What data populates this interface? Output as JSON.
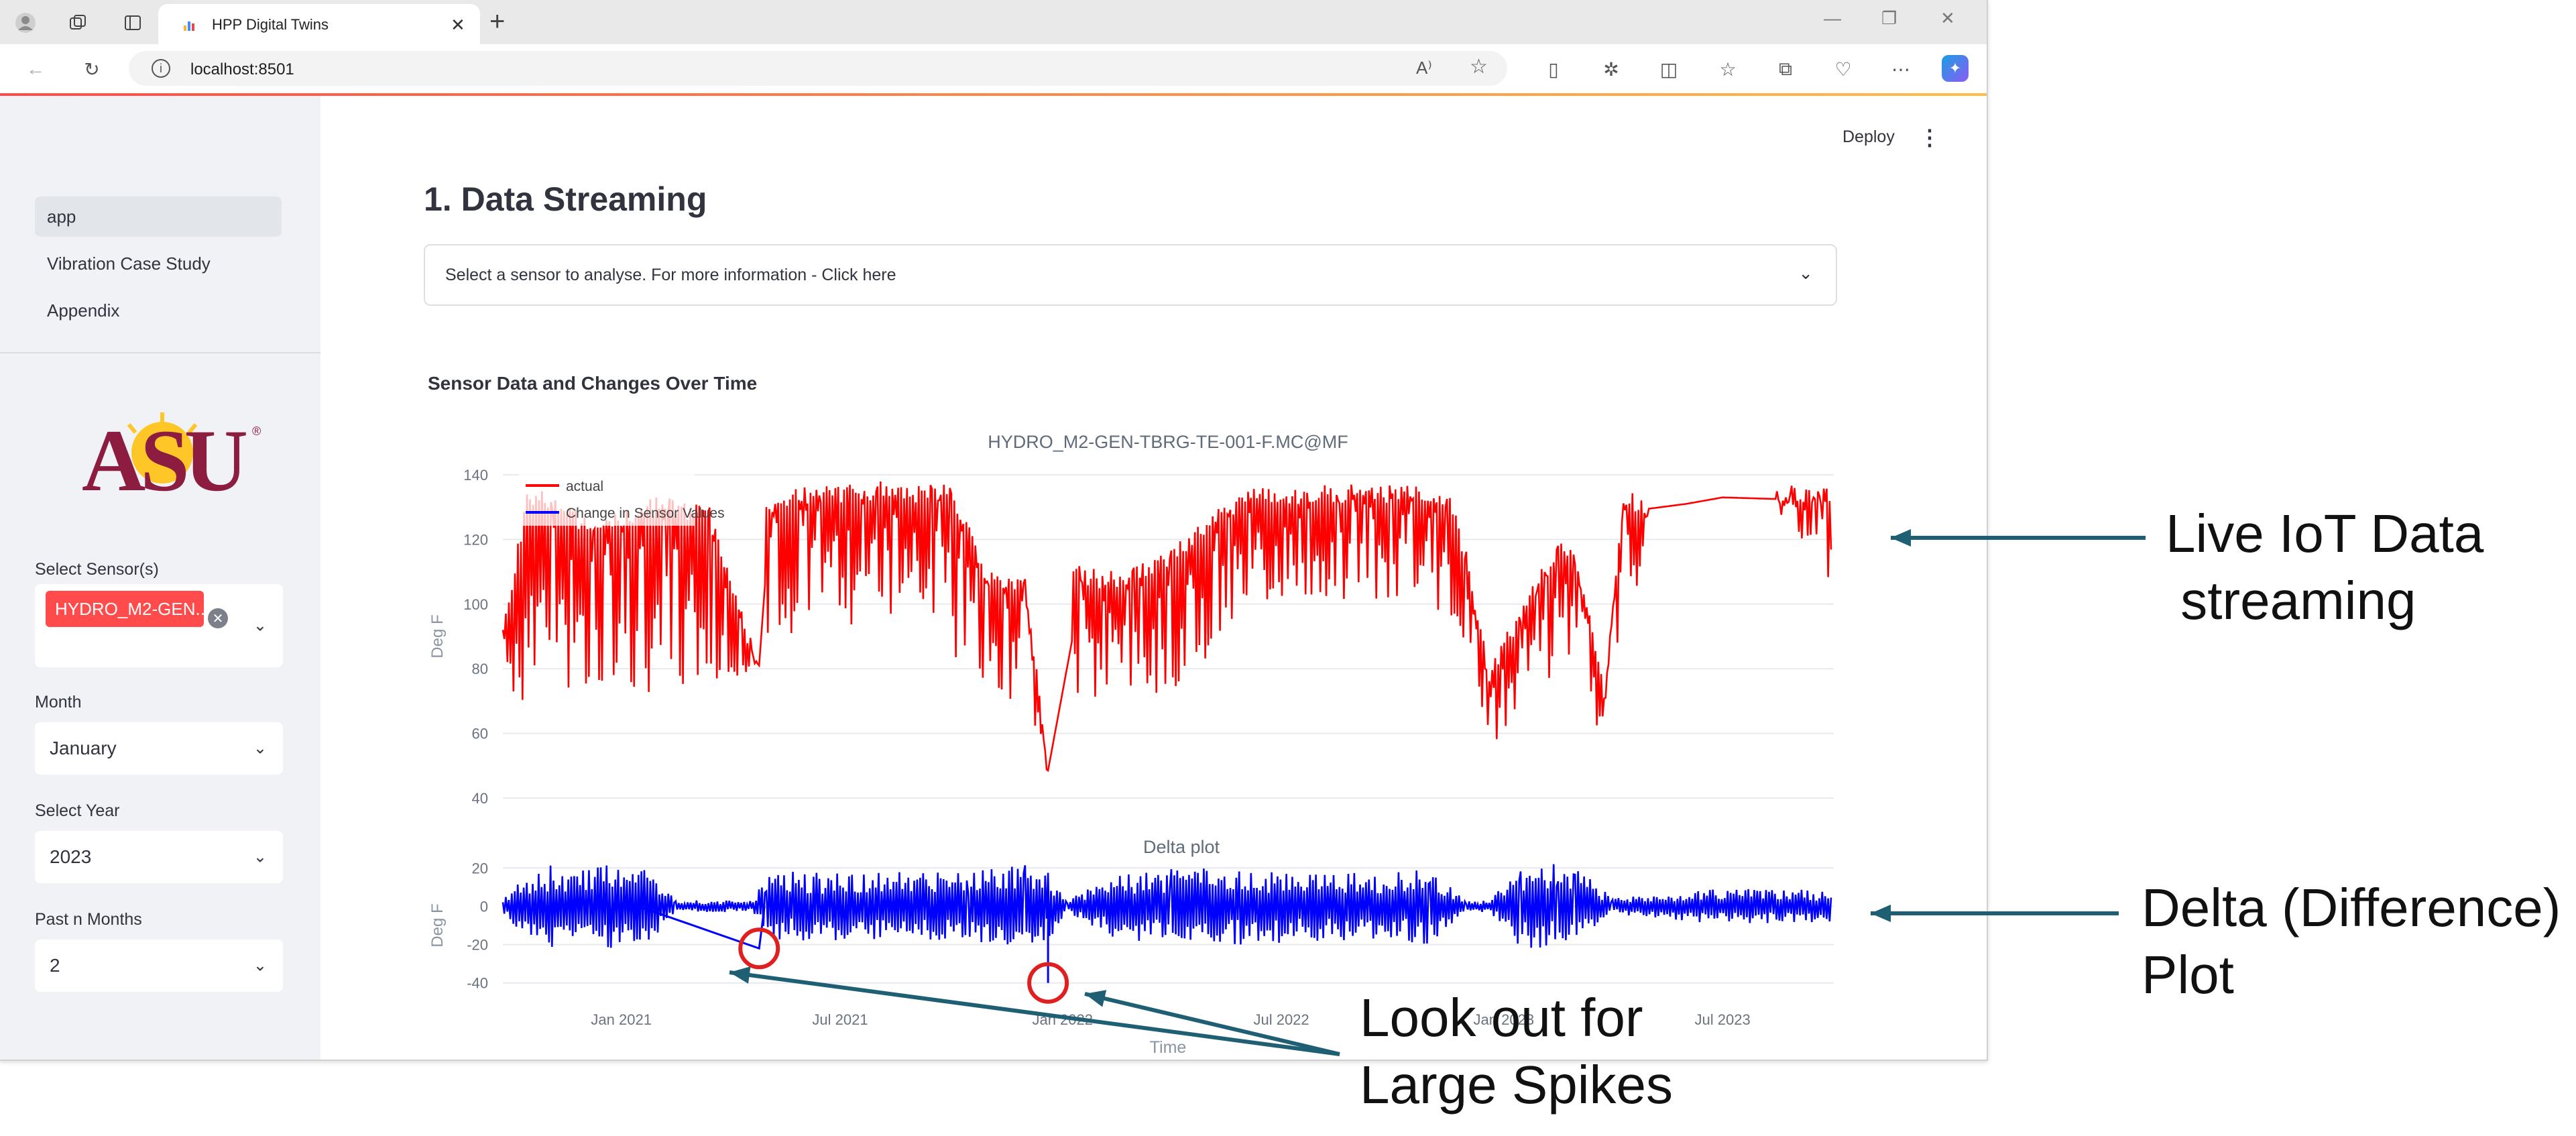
{
  "browser": {
    "tab_title": "HPP Digital Twins",
    "tab_close": "✕",
    "new_tab": "+",
    "url": "localhost:8501"
  },
  "app": {
    "deploy": "Deploy",
    "more": "⋮",
    "nav": [
      {
        "label": "app",
        "active": true
      },
      {
        "label": "Vibration Case Study",
        "active": false
      },
      {
        "label": "Appendix",
        "active": false
      }
    ],
    "logo_text": "ASU",
    "sensor_label": "Select Sensor(s)",
    "sensor_chip": "HYDRO_M2-GEN...",
    "month_label": "Month",
    "month_value": "January",
    "year_label": "Select Year",
    "year_value": "2023",
    "past_label": "Past n Months",
    "past_value": "2",
    "page_title": "1. Data Streaming",
    "expander_label": "Select a sensor to analyse. For more information - Click here",
    "section_title": "Sensor Data and Changes Over Time"
  },
  "chart_data": [
    {
      "type": "line",
      "title": "HYDRO_M2-GEN-TBRG-TE-001-F.MC@MF",
      "ylabel": "Deg F",
      "ylim": [
        40,
        140
      ],
      "yticks": [
        40,
        60,
        80,
        100,
        120,
        140
      ],
      "legend": [
        "actual",
        "Change in Sensor Values"
      ],
      "legend_position": "top-left",
      "series": [
        {
          "name": "actual",
          "color": "#ff0000",
          "x": [
            "2020-09-25",
            "2020-10-15",
            "2020-11-05",
            "2020-12-10",
            "2021-01-20",
            "2021-02-10",
            "2021-03-15",
            "2021-04-25",
            "2021-05-01",
            "2021-06-15",
            "2021-08-01",
            "2021-09-15",
            "2021-10-01",
            "2021-11-01",
            "2021-11-20",
            "2021-12-01",
            "2021-12-20",
            "2022-01-10",
            "2022-02-15",
            "2022-03-01",
            "2022-04-01",
            "2022-06-01",
            "2022-08-01",
            "2022-10-01",
            "2022-11-15",
            "2022-12-01",
            "2022-12-20",
            "2023-01-15",
            "2023-02-15",
            "2023-03-01",
            "2023-03-25",
            "2023-04-10",
            "2023-05-01",
            "2023-06-01",
            "2023-07-01",
            "2023-08-15",
            "2023-09-30"
          ],
          "lo": [
            62,
            72,
            68,
            72,
            70,
            75,
            72,
            80,
            90,
            92,
            95,
            98,
            85,
            70,
            70,
            72,
            47,
            70,
            72,
            72,
            72,
            95,
            100,
            102,
            95,
            88,
            52,
            70,
            78,
            78,
            55,
            80,
            126,
            128,
            130,
            128,
            105
          ],
          "hi": [
            92,
            135,
            135,
            125,
            133,
            133,
            130,
            82,
            134,
            137,
            138,
            137,
            137,
            110,
            110,
            110,
            50,
            112,
            110,
            112,
            118,
            136,
            137,
            137,
            136,
            118,
            80,
            100,
            120,
            118,
            75,
            135,
            133,
            134,
            136,
            137,
            137
          ]
        }
      ]
    },
    {
      "type": "line",
      "title": "Delta plot",
      "ylabel": "Deg F",
      "xlabel": "Time",
      "ylim": [
        -45,
        25
      ],
      "yticks": [
        -40,
        -20,
        0,
        20
      ],
      "xticks": [
        "Jan 2021",
        "Jul 2021",
        "Jan 2022",
        "Jul 2022",
        "Jan 2023",
        "Jul 2023"
      ],
      "series": [
        {
          "name": "Change in Sensor Values",
          "color": "#0000ff",
          "x": [
            "2020-09-25",
            "2020-11-01",
            "2020-12-15",
            "2021-01-20",
            "2021-02-15",
            "2021-04-20",
            "2021-05-01",
            "2021-07-01",
            "2021-09-15",
            "2021-10-15",
            "2021-12-01",
            "2021-12-20",
            "2022-01-05",
            "2022-02-15",
            "2022-04-01",
            "2022-06-01",
            "2022-08-01",
            "2022-10-01",
            "2022-11-01",
            "2022-12-01",
            "2022-12-20",
            "2023-01-15",
            "2023-02-15",
            "2023-03-01",
            "2023-04-01",
            "2023-06-01",
            "2023-07-15",
            "2023-09-30"
          ],
          "amp": [
            6,
            22,
            22,
            22,
            3,
            3,
            18,
            18,
            18,
            18,
            22,
            18,
            3,
            18,
            20,
            20,
            18,
            18,
            20,
            3,
            3,
            22,
            22,
            22,
            4,
            8,
            10,
            8
          ]
        }
      ],
      "spikes": [
        {
          "date": "2021-04-25",
          "value": -22
        },
        {
          "date": "2021-12-20",
          "value": -40
        }
      ]
    }
  ],
  "annotations": {
    "live": [
      "Live IoT Data",
      " streaming"
    ],
    "delta": [
      "Delta (Difference)",
      "Plot"
    ],
    "spikes": [
      "Look out for",
      "Large Spikes"
    ]
  }
}
